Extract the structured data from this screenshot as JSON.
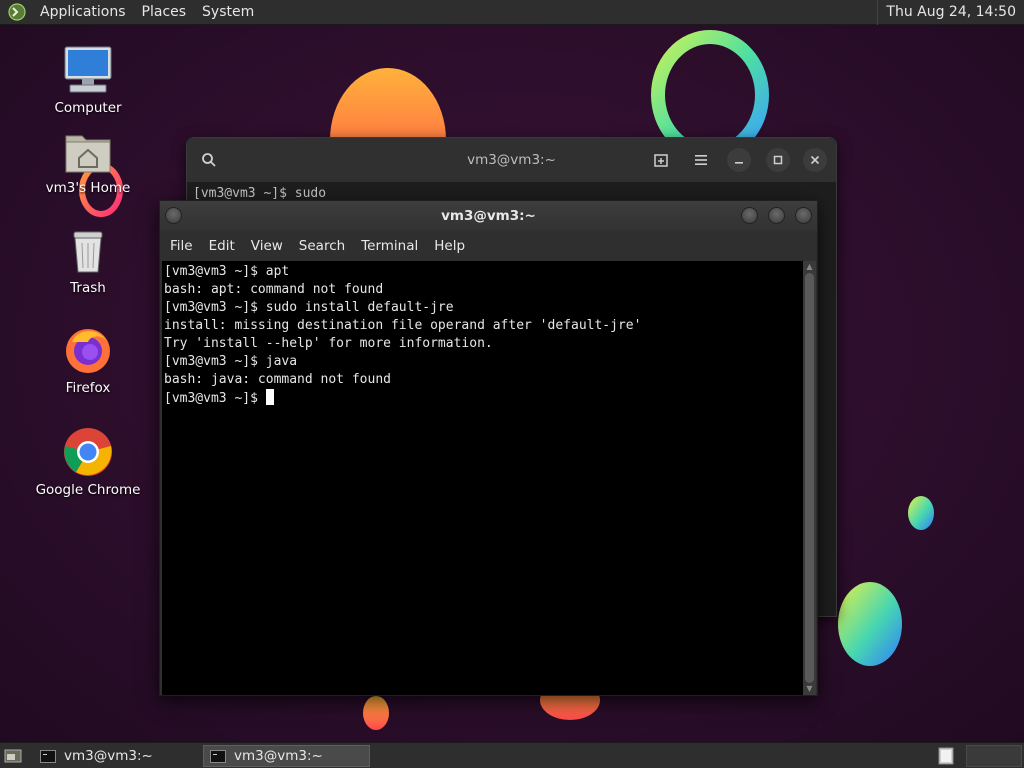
{
  "top_panel": {
    "menus": [
      "Applications",
      "Places",
      "System"
    ],
    "clock": "Thu Aug 24, 14:50"
  },
  "desktop_icons": [
    {
      "label": "Computer",
      "icon": "computer-icon"
    },
    {
      "label": "vm3's Home",
      "icon": "home-folder-icon"
    },
    {
      "label": "Trash",
      "icon": "trash-icon"
    },
    {
      "label": "Firefox",
      "icon": "firefox-icon"
    },
    {
      "label": "Google Chrome",
      "icon": "chrome-icon"
    }
  ],
  "back_terminal": {
    "title": "vm3@vm3:~",
    "content_line": "[vm3@vm3 ~]$ sudo"
  },
  "front_terminal": {
    "title": "vm3@vm3:~",
    "menu": [
      "File",
      "Edit",
      "View",
      "Search",
      "Terminal",
      "Help"
    ],
    "lines": [
      "[vm3@vm3 ~]$ apt",
      "bash: apt: command not found",
      "[vm3@vm3 ~]$ sudo install default-jre",
      "install: missing destination file operand after 'default-jre'",
      "Try 'install --help' for more information.",
      "[vm3@vm3 ~]$ java",
      "bash: java: command not found",
      "[vm3@vm3 ~]$ "
    ]
  },
  "taskbar": {
    "tasks": [
      "vm3@vm3:~",
      "vm3@vm3:~"
    ]
  },
  "colors": {
    "wallpaper": "#2a0d2a",
    "panel": "#2e2e2e",
    "terminal_bg": "#000000"
  }
}
